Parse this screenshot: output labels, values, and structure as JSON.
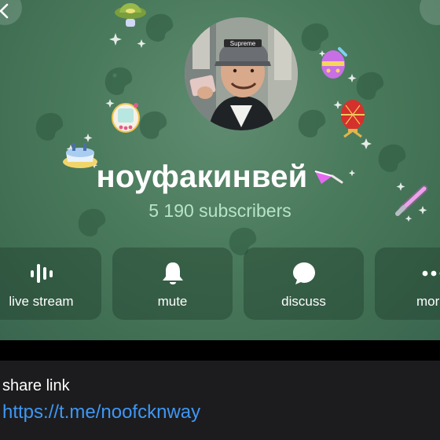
{
  "channel": {
    "name": "ноуфакинвей",
    "subscribers": "5 190 subscribers"
  },
  "actions": [
    {
      "label": "live stream",
      "icon": "live-stream-icon"
    },
    {
      "label": "mute",
      "icon": "bell-icon"
    },
    {
      "label": "discuss",
      "icon": "chat-bubble-icon"
    },
    {
      "label": "more",
      "icon": "more-dots-icon"
    }
  ],
  "info": {
    "share_label": "share link",
    "share_value": "https://t.me/noofcknway"
  },
  "colors": {
    "header_bg": "#4a7a5c",
    "subscribers_text": "#b7e4c6",
    "link": "#3e97f5",
    "info_bg": "#1c1c1e"
  }
}
